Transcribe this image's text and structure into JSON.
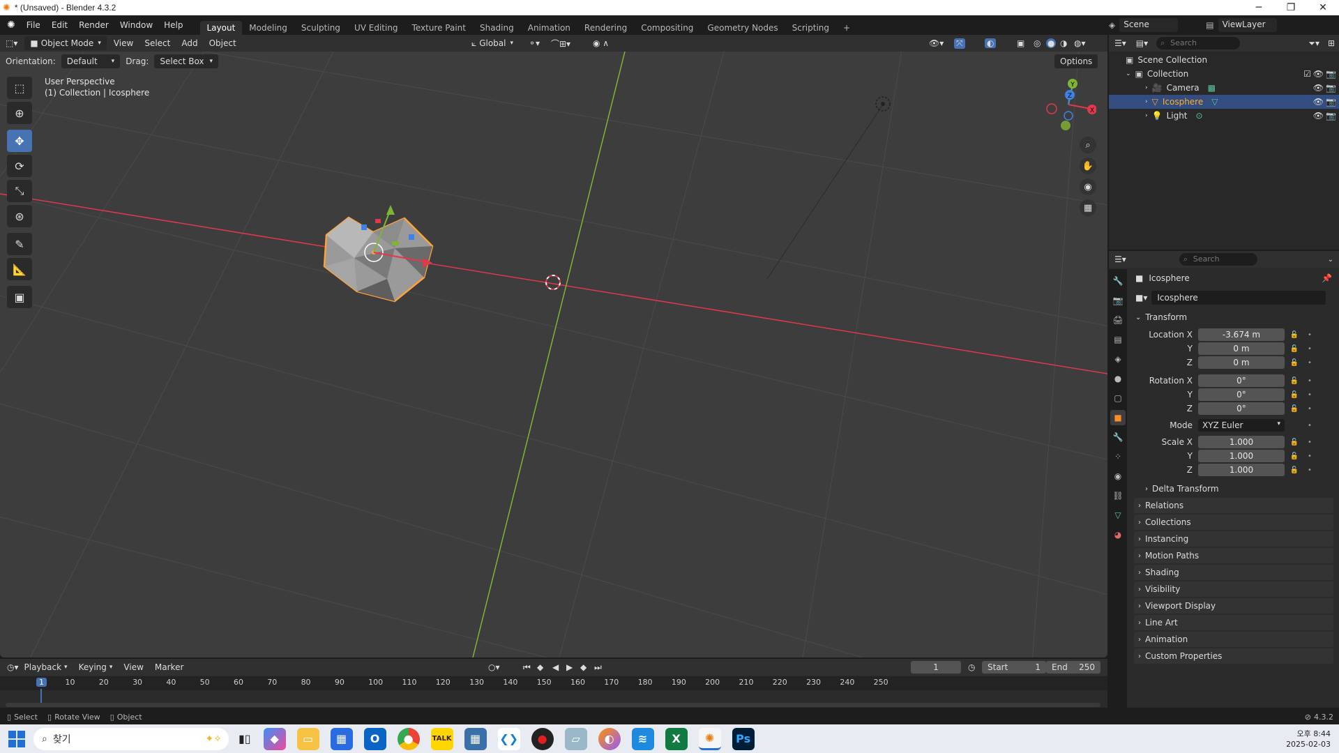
{
  "window": {
    "title": "* (Unsaved) - Blender 4.3.2",
    "minimize": "─",
    "maximize": "❐",
    "close": "✕"
  },
  "menu": {
    "items": [
      "File",
      "Edit",
      "Render",
      "Window",
      "Help"
    ],
    "workspaces": [
      "Layout",
      "Modeling",
      "Sculpting",
      "UV Editing",
      "Texture Paint",
      "Shading",
      "Animation",
      "Rendering",
      "Compositing",
      "Geometry Nodes",
      "Scripting"
    ],
    "active_workspace": "Layout",
    "add_tab": "+",
    "scene": "Scene",
    "view_layer": "ViewLayer"
  },
  "viewport_header": {
    "mode": "Object Mode",
    "menus": [
      "View",
      "Select",
      "Add",
      "Object"
    ],
    "transform_orientation": "Global",
    "options": "Options"
  },
  "viewport_sub": {
    "orientation_label": "Orientation:",
    "orientation_value": "Default",
    "drag_label": "Drag:",
    "drag_value": "Select Box"
  },
  "viewport_overlay": {
    "perspective": "User Perspective",
    "context": "(1) Collection | Icosphere"
  },
  "gizmo": {
    "x": "X",
    "y": "Y",
    "z": "Z"
  },
  "toolbar": {
    "tools": [
      "select-box",
      "cursor",
      "move",
      "rotate",
      "scale",
      "transform",
      "annotate",
      "measure",
      "add-cube"
    ],
    "active": "move"
  },
  "outliner": {
    "search_placeholder": "Search",
    "root": "Scene Collection",
    "collection": "Collection",
    "items": [
      {
        "name": "Camera",
        "selected": false
      },
      {
        "name": "Icosphere",
        "selected": true
      },
      {
        "name": "Light",
        "selected": false
      }
    ]
  },
  "properties": {
    "search_placeholder": "Search",
    "object_name": "Icosphere",
    "object_field": "Icosphere",
    "transform_label": "Transform",
    "location": {
      "label": "Location X",
      "x": "-3.674 m",
      "y": "0 m",
      "z": "0 m"
    },
    "rotation": {
      "label": "Rotation X",
      "x": "0°",
      "y": "0°",
      "z": "0°"
    },
    "mode_label": "Mode",
    "mode_value": "XYZ Euler",
    "scale": {
      "label": "Scale X",
      "x": "1.000",
      "y": "1.000",
      "z": "1.000"
    },
    "axis_y": "Y",
    "axis_z": "Z",
    "delta_transform": "Delta Transform",
    "panels": [
      "Relations",
      "Collections",
      "Instancing",
      "Motion Paths",
      "Shading",
      "Visibility",
      "Viewport Display",
      "Line Art",
      "Animation",
      "Custom Properties"
    ]
  },
  "timeline": {
    "menus": [
      "Playback",
      "Keying",
      "View",
      "Marker"
    ],
    "current_frame": "1",
    "start_label": "Start",
    "start_value": "1",
    "end_label": "End",
    "end_value": "250",
    "ruler": [
      "1",
      "10",
      "20",
      "30",
      "40",
      "50",
      "60",
      "70",
      "80",
      "90",
      "100",
      "110",
      "120",
      "130",
      "140",
      "150",
      "160",
      "170",
      "180",
      "190",
      "200",
      "210",
      "220",
      "230",
      "240",
      "250"
    ]
  },
  "statusbar": {
    "select": "Select",
    "rotate": "Rotate View",
    "object": "Object",
    "version": "4.3.2"
  },
  "taskbar": {
    "search": "찾기",
    "time": "오후 8:44",
    "date": "2025-02-03",
    "apps": [
      "Copilot",
      "File Explorer",
      "Store",
      "Outlook",
      "Chrome",
      "KakaoTalk",
      "Calculator",
      "VS Code",
      "Recorder",
      "Notes",
      "Firefox",
      "Windsurf",
      "Excel",
      "Blender",
      "Photoshop"
    ]
  },
  "colors": {
    "x_axis": "#e0384c",
    "y_axis": "#7fb536",
    "selection": "#ffa13a",
    "accent": "#4772b3"
  }
}
